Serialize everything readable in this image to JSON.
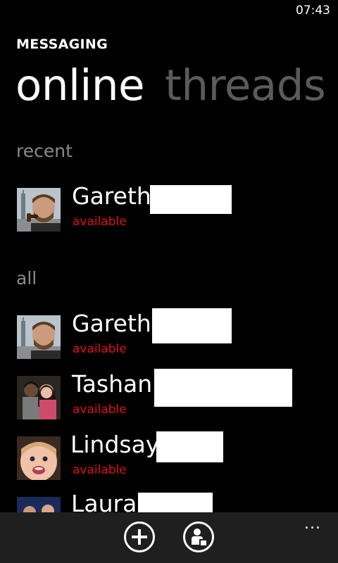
{
  "status_bar": {
    "time": "07:43"
  },
  "app": {
    "title": "MESSAGING"
  },
  "pivots": [
    {
      "label": "online"
    },
    {
      "label": "threads"
    }
  ],
  "sections": {
    "recent": "recent",
    "all": "all"
  },
  "recent": [
    {
      "name": "Gareth",
      "status": "available",
      "avatar": "bearded-man-photo"
    }
  ],
  "all": [
    {
      "name": "Gareth",
      "status": "available",
      "avatar": "bearded-man-photo"
    },
    {
      "name": "Tashan",
      "status": "available",
      "avatar": "two-people-photo"
    },
    {
      "name": "Lindsay",
      "status": "available",
      "avatar": "baby-photo"
    },
    {
      "name": "Laura",
      "status": "",
      "avatar": "group-photo"
    }
  ],
  "appbar": {
    "buttons": [
      {
        "icon": "add-icon"
      },
      {
        "icon": "contact-status-icon"
      }
    ],
    "more": "..."
  },
  "colors": {
    "background": "#000000",
    "status_available": "#e01010",
    "pivot_inactive": "#5b5b5b",
    "appbar": "#1f1f1f"
  }
}
